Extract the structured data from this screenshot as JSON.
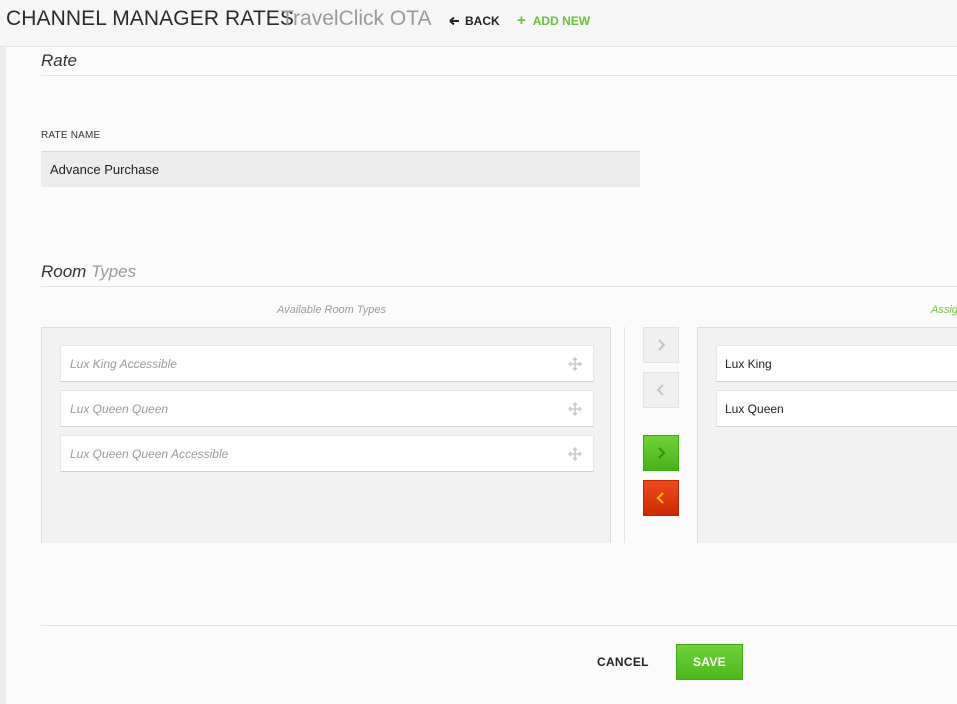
{
  "header": {
    "title": "CHANNEL MANAGER RATES",
    "subtitle": "TravelClick OTA",
    "back_label": "BACK",
    "add_new_label": "ADD NEW"
  },
  "rate_section": {
    "heading": "Rate",
    "rate_name_label": "RATE NAME",
    "rate_name_value": "Advance Purchase"
  },
  "room_types_section": {
    "heading_main": "Room",
    "heading_light": "Types",
    "available_caption": "Available Room Types",
    "assigned_caption": "Assig",
    "available": [
      {
        "label": "Lux King Accessible"
      },
      {
        "label": "Lux Queen Queen"
      },
      {
        "label": "Lux Queen Queen Accessible"
      }
    ],
    "assigned": [
      {
        "label": "Lux King"
      },
      {
        "label": "Lux Queen"
      }
    ]
  },
  "footer": {
    "cancel_label": "CANCEL",
    "save_label": "SAVE"
  },
  "colors": {
    "accent_green": "#6cbf3a",
    "danger_red": "#d9330b"
  },
  "icons": {
    "back": "arrow-left-icon",
    "add": "plus-icon",
    "drag": "move-icon",
    "move_right": "chevron-right-icon",
    "move_left": "chevron-left-icon"
  }
}
